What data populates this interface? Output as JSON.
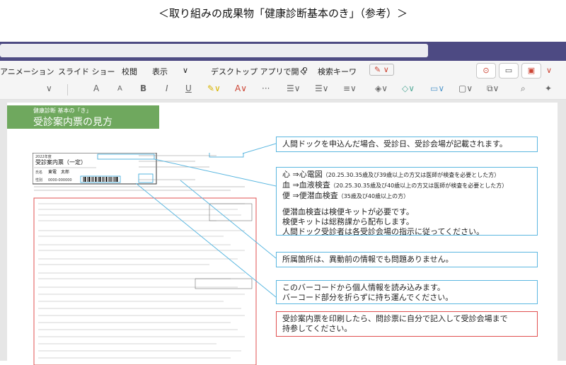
{
  "caption": "＜取り組みの成果物「健康診断基本のき」（参考）＞",
  "menu": [
    "アニメーション",
    "スライド ショー",
    "校閲",
    "表示",
    "デスクトップ アプリで開く",
    "検索キーワ"
  ],
  "toolbar": {
    "grow_font": "A",
    "shrink_font": "A",
    "bold": "B",
    "italic": "I",
    "underline": "U",
    "more": "···"
  },
  "slide": {
    "header_sub": "健康診断 基本の「き」",
    "header_title": "受診案内票の見方",
    "doc": {
      "year": "2022年度",
      "title": "受診案内票（一定）",
      "name_label": "氏名",
      "name_value": "東電　太郎",
      "id_label": "性別",
      "id_value": "0000-000000"
    },
    "callouts": {
      "dock": "人間ドックを申込んだ場合、受診日、受診会場が記載されます。",
      "exam_line1_main": "心 ⇒心電図",
      "exam_line1_note": "（20.25.30.35歳及び39歳以上の方又は医師が検査を必要とした方）",
      "exam_line2_main": "血 ⇒血液検査",
      "exam_line2_note": "（20.25.30.35歳及び40歳以上の方又は医師が検査を必要とした方）",
      "exam_line3_main": "便 ⇒便潜血検査",
      "exam_line3_note": "（35歳及び40歳以上の方）",
      "exam_kit1": "便潜血検査は検便キットが必要です。",
      "exam_kit2": "検便キットは総務課から配布します。",
      "exam_kit3": "人間ドック受診者は各受診会場の指示に従ってください。",
      "dept": "所属箇所は、異動前の情報でも問題ありません。",
      "barcode1": "このバーコードから個人情報を読み込みます。",
      "barcode2": "バーコード部分を折らずに持ち運んでください。",
      "print1": "受診案内票を印刷したら、問診票に自分で記入して受診会場まで",
      "print2": "持参してください。"
    }
  },
  "colors": {
    "app_bar": "#4d4a83",
    "header_green": "#6fa85e",
    "callout_blue": "#5bb7e0",
    "callout_red": "#e05050",
    "accent_red": "#c43333"
  }
}
